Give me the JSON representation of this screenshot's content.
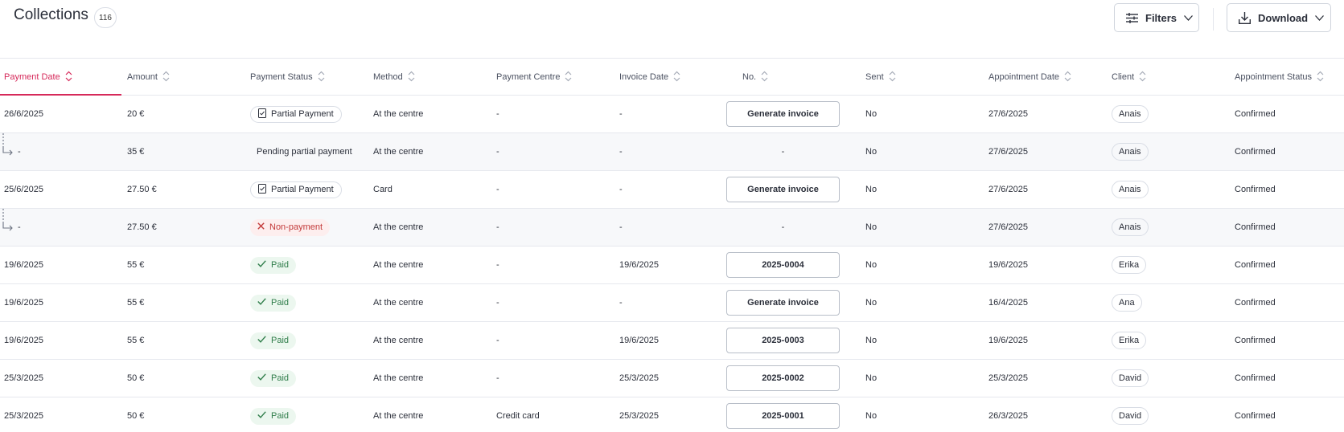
{
  "header": {
    "title": "Collections",
    "count": "116",
    "filters_label": "Filters",
    "download_label": "Download"
  },
  "columns": [
    {
      "label": "Payment Date"
    },
    {
      "label": "Amount"
    },
    {
      "label": "Payment Status"
    },
    {
      "label": "Method"
    },
    {
      "label": "Payment Centre"
    },
    {
      "label": "Invoice Date"
    },
    {
      "label": "No."
    },
    {
      "label": "Sent"
    },
    {
      "label": "Appointment Date"
    },
    {
      "label": "Client"
    },
    {
      "label": "Appointment Status"
    }
  ],
  "sorted_column": "Payment Date",
  "rows": [
    {
      "child": false,
      "payment_date": "26/6/2025",
      "amount": "20 €",
      "status": "Partial Payment",
      "status_type": "partial",
      "method": "At the centre",
      "centre": "-",
      "invoice_date": "-",
      "no": "Generate invoice",
      "no_type": "button",
      "sent": "No",
      "appointment_date": "27/6/2025",
      "client": "Anais",
      "appointment_status": "Confirmed"
    },
    {
      "child": true,
      "payment_date": "-",
      "amount": "35 €",
      "status": "Pending partial payment",
      "status_type": "text",
      "method": "At the centre",
      "centre": "-",
      "invoice_date": "-",
      "no": "-",
      "no_type": "text",
      "sent": "No",
      "appointment_date": "27/6/2025",
      "client": "Anais",
      "appointment_status": "Confirmed"
    },
    {
      "child": false,
      "payment_date": "25/6/2025",
      "amount": "27.50 €",
      "status": "Partial Payment",
      "status_type": "partial",
      "method": "Card",
      "centre": "-",
      "invoice_date": "-",
      "no": "Generate invoice",
      "no_type": "button",
      "sent": "No",
      "appointment_date": "27/6/2025",
      "client": "Anais",
      "appointment_status": "Confirmed"
    },
    {
      "child": true,
      "payment_date": "-",
      "amount": "27.50 €",
      "status": "Non-payment",
      "status_type": "non",
      "method": "At the centre",
      "centre": "-",
      "invoice_date": "-",
      "no": "-",
      "no_type": "text",
      "sent": "No",
      "appointment_date": "27/6/2025",
      "client": "Anais",
      "appointment_status": "Confirmed"
    },
    {
      "child": false,
      "payment_date": "19/6/2025",
      "amount": "55 €",
      "status": "Paid",
      "status_type": "paid",
      "method": "At the centre",
      "centre": "-",
      "invoice_date": "19/6/2025",
      "no": "2025-0004",
      "no_type": "button",
      "sent": "No",
      "appointment_date": "19/6/2025",
      "client": "Erika",
      "appointment_status": "Confirmed"
    },
    {
      "child": false,
      "payment_date": "19/6/2025",
      "amount": "55 €",
      "status": "Paid",
      "status_type": "paid",
      "method": "At the centre",
      "centre": "-",
      "invoice_date": "-",
      "no": "Generate invoice",
      "no_type": "button",
      "sent": "No",
      "appointment_date": "16/4/2025",
      "client": "Ana",
      "appointment_status": "Confirmed"
    },
    {
      "child": false,
      "payment_date": "19/6/2025",
      "amount": "55 €",
      "status": "Paid",
      "status_type": "paid",
      "method": "At the centre",
      "centre": "-",
      "invoice_date": "19/6/2025",
      "no": "2025-0003",
      "no_type": "button",
      "sent": "No",
      "appointment_date": "19/6/2025",
      "client": "Erika",
      "appointment_status": "Confirmed"
    },
    {
      "child": false,
      "payment_date": "25/3/2025",
      "amount": "50 €",
      "status": "Paid",
      "status_type": "paid",
      "method": "At the centre",
      "centre": "-",
      "invoice_date": "25/3/2025",
      "no": "2025-0002",
      "no_type": "button",
      "sent": "No",
      "appointment_date": "25/3/2025",
      "client": "David",
      "appointment_status": "Confirmed"
    },
    {
      "child": false,
      "payment_date": "25/3/2025",
      "amount": "50 €",
      "status": "Paid",
      "status_type": "paid",
      "method": "At the centre",
      "centre": "Credit card",
      "invoice_date": "25/3/2025",
      "no": "2025-0001",
      "no_type": "button",
      "sent": "No",
      "appointment_date": "26/3/2025",
      "client": "David",
      "appointment_status": "Confirmed"
    }
  ],
  "colors": {
    "accent": "#d6295a",
    "paid_bg": "#ecf7ef",
    "paid_text": "#2f7d4a",
    "non_bg": "#fdeeee",
    "non_text": "#c33a3a"
  }
}
